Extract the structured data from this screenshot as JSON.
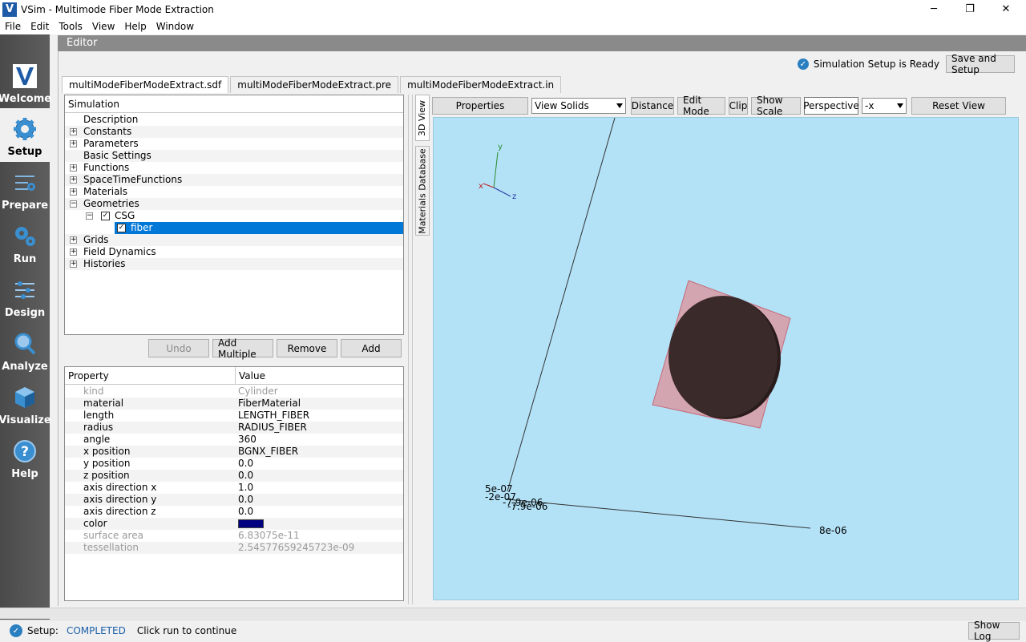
{
  "window": {
    "title": "VSim - Multimode Fiber Mode Extraction",
    "minimize_glyph": "─",
    "restore_glyph": "❐",
    "close_glyph": "✕"
  },
  "menu": [
    "File",
    "Edit",
    "Tools",
    "View",
    "Help",
    "Window"
  ],
  "sidebar": {
    "items": [
      {
        "label": "Welcome",
        "icon": "vsim-logo-icon"
      },
      {
        "label": "Setup",
        "icon": "gear-icon"
      },
      {
        "label": "Prepare",
        "icon": "sliders-gear-icon"
      },
      {
        "label": "Run",
        "icon": "run-gears-icon"
      },
      {
        "label": "Design",
        "icon": "sliders-icon"
      },
      {
        "label": "Analyze",
        "icon": "magnifier-icon"
      },
      {
        "label": "Visualize",
        "icon": "cube-icon"
      },
      {
        "label": "Help",
        "icon": "help-icon"
      }
    ],
    "active": "Setup"
  },
  "editor": {
    "title": "Editor",
    "ready_text": "Simulation Setup is Ready",
    "save_setup_label": "Save and Setup"
  },
  "file_tabs": [
    "multiModeFiberModeExtract.sdf",
    "multiModeFiberModeExtract.pre",
    "multiModeFiberModeExtract.in"
  ],
  "tree": {
    "header": "Simulation",
    "rows": [
      {
        "label": "Description"
      },
      {
        "label": "Constants",
        "expander": "+"
      },
      {
        "label": "Parameters",
        "expander": "+"
      },
      {
        "label": "Basic Settings"
      },
      {
        "label": "Functions",
        "expander": "+"
      },
      {
        "label": "SpaceTimeFunctions",
        "expander": "+"
      },
      {
        "label": "Materials",
        "expander": "+"
      },
      {
        "label": "Geometries",
        "expander": "−"
      },
      {
        "label": "CSG",
        "expander": "−",
        "checked": true
      },
      {
        "label": "fiber",
        "checked": true,
        "selected": true
      },
      {
        "label": "Grids",
        "expander": "+"
      },
      {
        "label": "Field Dynamics",
        "expander": "+"
      },
      {
        "label": "Histories",
        "expander": "+"
      }
    ],
    "buttons": {
      "undo": "Undo",
      "add_multiple": "Add Multiple",
      "remove": "Remove",
      "add": "Add"
    }
  },
  "properties": {
    "header_property": "Property",
    "header_value": "Value",
    "rows": [
      {
        "name": "kind",
        "value": "Cylinder",
        "dim": true
      },
      {
        "name": "material",
        "value": "FiberMaterial"
      },
      {
        "name": "length",
        "value": "LENGTH_FIBER"
      },
      {
        "name": "radius",
        "value": "RADIUS_FIBER"
      },
      {
        "name": "angle",
        "value": "360"
      },
      {
        "name": "x position",
        "value": "BGNX_FIBER"
      },
      {
        "name": "y position",
        "value": "0.0"
      },
      {
        "name": "z position",
        "value": "0.0"
      },
      {
        "name": "axis direction x",
        "value": "1.0"
      },
      {
        "name": "axis direction y",
        "value": "0.0"
      },
      {
        "name": "axis direction z",
        "value": "0.0"
      },
      {
        "name": "color",
        "value": "",
        "swatch": "#000080"
      },
      {
        "name": "surface area",
        "value": "6.83075e-11",
        "dim": true
      },
      {
        "name": "tessellation",
        "value": "2.54577659245723e-09",
        "dim": true
      }
    ]
  },
  "vertical_tabs": [
    "3D View",
    "Materials Database"
  ],
  "view_toolbar": {
    "properties": "Properties",
    "view_mode": "View Solids",
    "distance": "Distance",
    "edit_mode": "Edit Mode",
    "clip": "Clip",
    "show_scale": "Show Scale",
    "perspective": "Perspective",
    "axis": "-x",
    "reset_view": "Reset View"
  },
  "scene": {
    "axis_labels": {
      "y": "y",
      "x": "x",
      "z": "z"
    },
    "tick_labels": [
      "5e-07",
      "-2e-07",
      "-7.9e-06",
      "-7.9e-06",
      "8e-06"
    ],
    "fiber_color": "#3a2a2a",
    "box_color": "#d89aa4",
    "background": "#b3e2f7"
  },
  "status": {
    "prefix": "Setup:",
    "state": "COMPLETED",
    "message": "Click run to continue",
    "show_log": "Show Log"
  }
}
